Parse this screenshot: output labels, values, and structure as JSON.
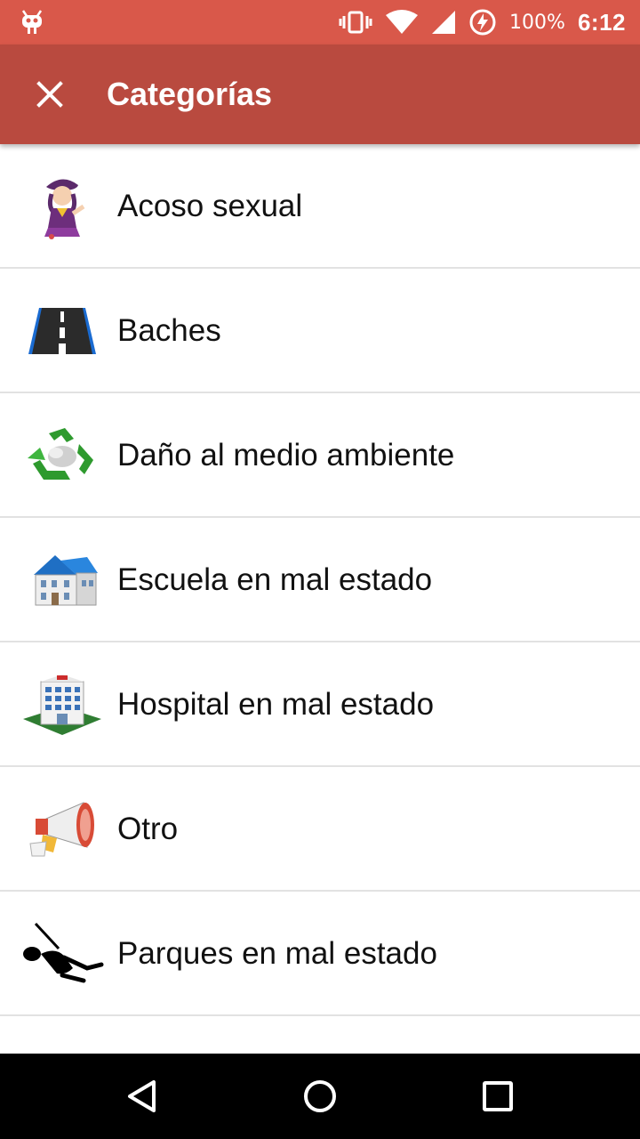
{
  "status_bar": {
    "battery_percent": "100%",
    "time": "6:12",
    "icons": [
      "android-debug-icon",
      "vibrate-icon",
      "wifi-icon",
      "signal-icon",
      "battery-charging-icon"
    ]
  },
  "app_bar": {
    "title": "Categorías",
    "close_icon": "close-icon",
    "color": "#b94a3f",
    "status_color": "#d9584a"
  },
  "categories": [
    {
      "label": "Acoso sexual",
      "icon": "harassment-icon"
    },
    {
      "label": "Baches",
      "icon": "road-icon"
    },
    {
      "label": "Daño al medio ambiente",
      "icon": "recycle-icon"
    },
    {
      "label": "Escuela en mal estado",
      "icon": "school-icon"
    },
    {
      "label": "Hospital en mal estado",
      "icon": "hospital-icon"
    },
    {
      "label": "Otro",
      "icon": "megaphone-icon"
    },
    {
      "label": "Parques en mal estado",
      "icon": "swing-icon"
    }
  ],
  "nav_bar": {
    "icons": [
      "back-icon",
      "home-icon",
      "recents-icon"
    ]
  }
}
